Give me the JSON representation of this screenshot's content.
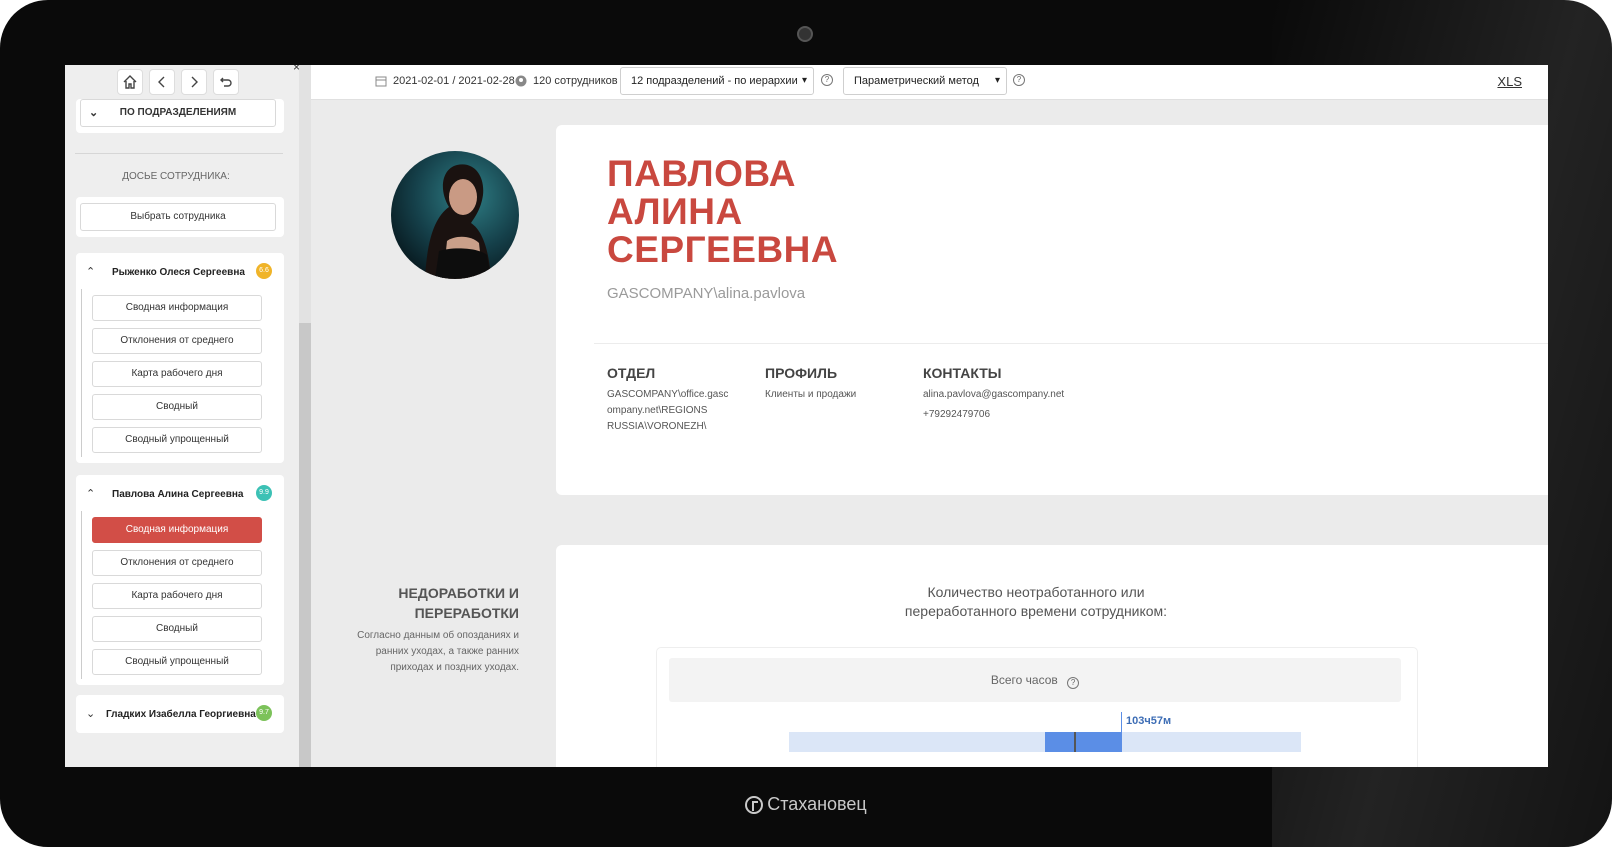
{
  "device": {
    "brand": "Стахановец"
  },
  "sidebar": {
    "nav_icons": [
      "home-icon",
      "chevron-left-icon",
      "chevron-right-icon",
      "undo-icon"
    ],
    "close_glyph": "×",
    "group_label": "ПО ПОДРАЗДЕЛЕНИЯМ",
    "dossier_heading": "ДОСЬЕ СОТРУДНИКА:",
    "choose_employee": "Выбрать сотрудника",
    "employees": [
      {
        "name": "Рыженко Олеся Сергеевна",
        "score": "6.6",
        "badge_color": "#f0b429",
        "expanded": true,
        "items": [
          "Сводная информация",
          "Отклонения от среднего",
          "Карта рабочего дня",
          "Сводный",
          "Сводный упрощенный"
        ]
      },
      {
        "name": "Павлова Алина Сергеевна",
        "score": "9.9",
        "badge_color": "#3cc1b5",
        "expanded": true,
        "active_item": "Сводная информация",
        "items": [
          "Сводная информация",
          "Отклонения от среднего",
          "Карта рабочего дня",
          "Сводный",
          "Сводный упрощенный"
        ]
      },
      {
        "name": "Гладких Изабелла Георгиевна",
        "score": "9.7",
        "badge_color": "#7cc25a",
        "expanded": false
      }
    ]
  },
  "topbar": {
    "date_range": "2021-02-01 / 2021-02-28",
    "employees_count": "120 сотрудников",
    "department_select": "12 подразделений - по иерархии",
    "method_select": "Параметрический метод",
    "export_link": "XLS"
  },
  "profile": {
    "name_line1": "ПАВЛОВА",
    "name_line2": "АЛИНА",
    "name_line3": "СЕРГЕЕВНА",
    "login": "GASCOMPANY\\alina.pavlova",
    "accent_color": "#c9483f",
    "department": {
      "title": "ОТДЕЛ",
      "line1": "GASCOMPANY\\office.gasc",
      "line2": "ompany.net\\REGIONS",
      "line3": "RUSSIA\\VORONEZH\\"
    },
    "profile_col": {
      "title": "ПРОФИЛЬ",
      "value": "Клиенты и продажи"
    },
    "contacts": {
      "title": "КОНТАКТЫ",
      "email": "alina.pavlova@gascompany.net",
      "phone": "+79292479706"
    }
  },
  "underwork": {
    "title_line1": "НЕДОРАБОТКИ И",
    "title_line2": "ПЕРЕРАБОТКИ",
    "desc_line1": "Согласно данным об опозданиях и",
    "desc_line2": "ранних уходах, а также ранних",
    "desc_line3": "приходах и поздних уходах.",
    "chart_title_line1": "Количество неотработанного или",
    "chart_title_line2": "переработанного времени сотрудником:",
    "panel_title": "Всего часов",
    "bar_value_label": "103ч57м"
  }
}
